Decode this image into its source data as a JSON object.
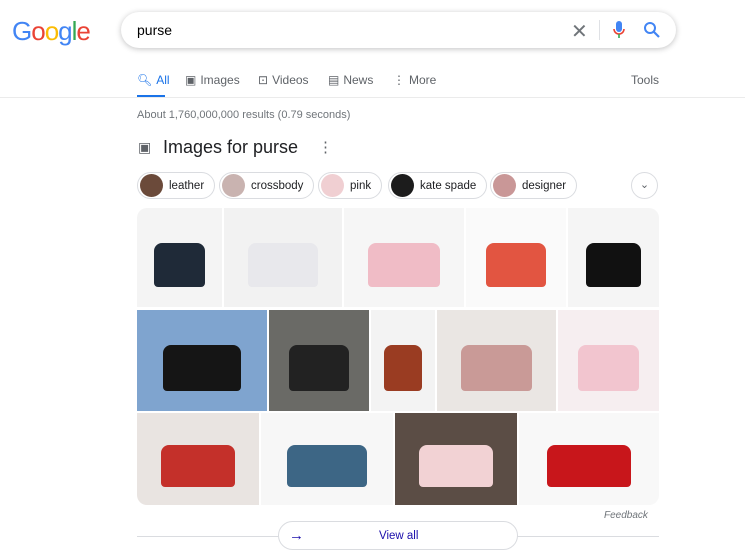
{
  "logo": "Google",
  "search": {
    "query": "purse"
  },
  "tabs": [
    {
      "label": "All",
      "icon": "search-icon",
      "active": true
    },
    {
      "label": "Images",
      "icon": "image-icon"
    },
    {
      "label": "Videos",
      "icon": "play-icon"
    },
    {
      "label": "News",
      "icon": "news-icon"
    },
    {
      "label": "More",
      "icon": "dots-vertical-icon"
    }
  ],
  "tools": "Tools",
  "stats": "About 1,760,000,000 results (0.79 seconds)",
  "images_section": {
    "title": "Images for purse",
    "chips": [
      {
        "label": "leather",
        "color": "#6b4a3a"
      },
      {
        "label": "crossbody",
        "color": "#c9b3b0"
      },
      {
        "label": "pink",
        "color": "#f0cfd2"
      },
      {
        "label": "kate spade",
        "color": "#1c1c1c"
      },
      {
        "label": "designer",
        "color": "#c99797"
      }
    ],
    "feedback": "Feedback",
    "view_all": "View all"
  },
  "tiles": [
    {
      "bg": "#f4f4f4",
      "bag": "#1f2a38"
    },
    {
      "bg": "#f2f2f2",
      "bag": "#e8e8ec"
    },
    {
      "bg": "#f6f6f6",
      "bag": "#f0bcc6"
    },
    {
      "bg": "#fafafa",
      "bag": "#e25541"
    },
    {
      "bg": "#f5f5f5",
      "bag": "#111"
    },
    {
      "bg": "#7fa4cf",
      "bag": "#151515"
    },
    {
      "bg": "#6a6a66",
      "bag": "#222"
    },
    {
      "bg": "#f3f3f3",
      "bag": "#9a3c22"
    },
    {
      "bg": "#eae6e3",
      "bag": "#c99a97"
    },
    {
      "bg": "#f6eef0",
      "bag": "#f2c5cf"
    },
    {
      "bg": "#e9e4e1",
      "bag": "#c4302a"
    },
    {
      "bg": "#f7f7f7",
      "bag": "#3d6685"
    },
    {
      "bg": "#5b4d45",
      "bag": "#f2d2d4"
    },
    {
      "bg": "#f8f8f8",
      "bag": "#c8161b"
    }
  ]
}
